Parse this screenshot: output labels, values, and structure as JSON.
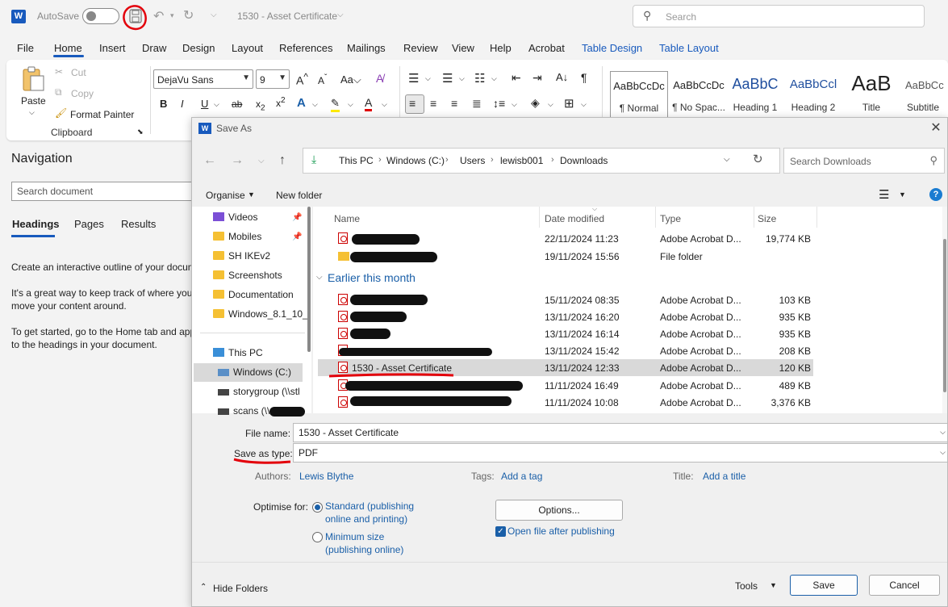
{
  "titlebar": {
    "app_icon": "W",
    "autosave_label": "AutoSave",
    "document_title": "1530 - Asset Certificate",
    "search_placeholder": "Search"
  },
  "menu_tabs": [
    "File",
    "Home",
    "Insert",
    "Draw",
    "Design",
    "Layout",
    "References",
    "Mailings",
    "Review",
    "View",
    "Help",
    "Acrobat",
    "Table Design",
    "Table Layout"
  ],
  "ribbon": {
    "clipboard": {
      "paste": "Paste",
      "cut": "Cut",
      "copy": "Copy",
      "format_painter": "Format Painter",
      "group_label": "Clipboard"
    },
    "font": {
      "family": "DejaVu Sans",
      "size": "9"
    },
    "styles": [
      {
        "sample": "AaBbCcDc",
        "name": "¶ Normal"
      },
      {
        "sample": "AaBbCcDc",
        "name": "¶ No Spac..."
      },
      {
        "sample": "AaBbC",
        "name": "Heading 1"
      },
      {
        "sample": "AaBbCcl",
        "name": "Heading 2"
      },
      {
        "sample": "AaB",
        "name": "Title"
      },
      {
        "sample": "AaBbCc",
        "name": "Subtitle"
      }
    ]
  },
  "navigation": {
    "title": "Navigation",
    "search_placeholder": "Search document",
    "tabs": [
      "Headings",
      "Pages",
      "Results"
    ],
    "text1": "Create an interactive outline of your docum",
    "text2a": "It's a great way to keep track of where you",
    "text2b": "move your content around.",
    "text3a": "To get started, go to the Home tab and app",
    "text3b": "to the headings in your document."
  },
  "dialog": {
    "title": "Save As",
    "breadcrumb": [
      "This PC",
      "Windows (C:)",
      "Users",
      "lewisb001",
      "Downloads"
    ],
    "search_placeholder": "Search Downloads",
    "organise": "Organise",
    "new_folder": "New folder",
    "tree": [
      {
        "label": "Videos",
        "pinned": true
      },
      {
        "label": "Mobiles",
        "pinned": true
      },
      {
        "label": "SH IKEv2"
      },
      {
        "label": "Screenshots"
      },
      {
        "label": "Documentation"
      },
      {
        "label": "Windows_8.1_10_"
      },
      {
        "label": "This PC"
      },
      {
        "label": "Windows (C:)"
      },
      {
        "label": "storygroup (\\\\stl"
      },
      {
        "label": "scans (\\\\"
      }
    ],
    "columns": [
      "Name",
      "Date modified",
      "Type",
      "Size"
    ],
    "group_earlier": "Earlier this month",
    "files": [
      {
        "name": "",
        "date": "22/11/2024 11:23",
        "type": "Adobe Acrobat D...",
        "size": "19,774 KB"
      },
      {
        "name": "",
        "date": "19/11/2024 15:56",
        "type": "File folder",
        "size": ""
      },
      {
        "name": "",
        "date": "15/11/2024 08:35",
        "type": "Adobe Acrobat D...",
        "size": "103 KB"
      },
      {
        "name": "",
        "date": "13/11/2024 16:20",
        "type": "Adobe Acrobat D...",
        "size": "935 KB"
      },
      {
        "name": "",
        "date": "13/11/2024 16:14",
        "type": "Adobe Acrobat D...",
        "size": "935 KB"
      },
      {
        "name": "",
        "date": "13/11/2024 15:42",
        "type": "Adobe Acrobat D...",
        "size": "208 KB"
      },
      {
        "name": "1530 - Asset Certificate",
        "date": "13/11/2024 12:33",
        "type": "Adobe Acrobat D...",
        "size": "120 KB"
      },
      {
        "name": "",
        "date": "11/11/2024 16:49",
        "type": "Adobe Acrobat D...",
        "size": "489 KB"
      },
      {
        "name": "",
        "date": "11/11/2024 10:08",
        "type": "Adobe Acrobat D...",
        "size": "3,376 KB"
      }
    ],
    "file_name_label": "File name:",
    "file_name_value": "1530 - Asset Certificate",
    "save_type_label": "Save as type:",
    "save_type_value": "PDF",
    "authors_label": "Authors:",
    "authors_value": "Lewis Blythe",
    "tags_label": "Tags:",
    "tags_value": "Add a tag",
    "title_label": "Title:",
    "title_value": "Add a title",
    "optimise_label": "Optimise for:",
    "opt_standard_1": "Standard (publishing",
    "opt_standard_2": "online and printing)",
    "opt_minimum_1": "Minimum size",
    "opt_minimum_2": "(publishing online)",
    "options_button": "Options...",
    "open_after": "Open file after publishing",
    "hide_folders": "Hide Folders",
    "tools": "Tools",
    "save": "Save",
    "cancel": "Cancel"
  }
}
